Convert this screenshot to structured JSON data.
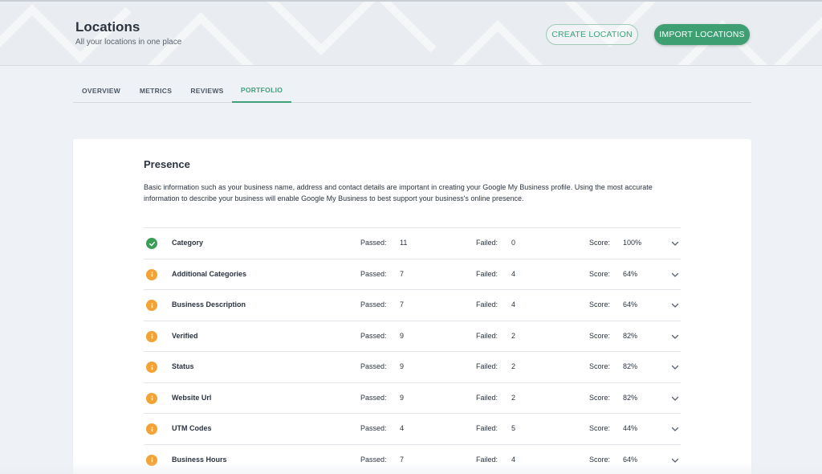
{
  "header": {
    "title": "Locations",
    "subtitle": "All your locations in one place",
    "create_label": "CREATE LOCATION",
    "import_label": "IMPORT LOCATIONS"
  },
  "tabs": [
    {
      "label": "OVERVIEW",
      "active": false
    },
    {
      "label": "METRICS",
      "active": false
    },
    {
      "label": "REVIEWS",
      "active": false
    },
    {
      "label": "PORTFOLIO",
      "active": true
    }
  ],
  "presence": {
    "title": "Presence",
    "description": "Basic information such as your business name, address and contact details are important in creating your Google My Business profile. Using the most accurate information to describe your business will enable Google My Business to best support your business's online presence.",
    "labels": {
      "passed": "Passed:",
      "failed": "Failed:",
      "score": "Score:"
    },
    "rows": [
      {
        "name": "Category",
        "passed": "11",
        "failed": "0",
        "score": "100%",
        "status": "pass"
      },
      {
        "name": "Additional Categories",
        "passed": "7",
        "failed": "4",
        "score": "64%",
        "status": "warn"
      },
      {
        "name": "Business Description",
        "passed": "7",
        "failed": "4",
        "score": "64%",
        "status": "warn"
      },
      {
        "name": "Verified",
        "passed": "9",
        "failed": "2",
        "score": "82%",
        "status": "warn"
      },
      {
        "name": "Status",
        "passed": "9",
        "failed": "2",
        "score": "82%",
        "status": "warn"
      },
      {
        "name": "Website Url",
        "passed": "9",
        "failed": "2",
        "score": "82%",
        "status": "warn"
      },
      {
        "name": "UTM Codes",
        "passed": "4",
        "failed": "5",
        "score": "44%",
        "status": "warn"
      },
      {
        "name": "Business Hours",
        "passed": "7",
        "failed": "4",
        "score": "64%",
        "status": "warn"
      }
    ]
  },
  "colors": {
    "accent": "#3fa27a",
    "pass": "#3b9e58",
    "warn": "#f4a234"
  },
  "icons": {
    "pass": "check-circle-icon",
    "warn": "info-circle-icon",
    "expand": "chevron-down-icon"
  }
}
